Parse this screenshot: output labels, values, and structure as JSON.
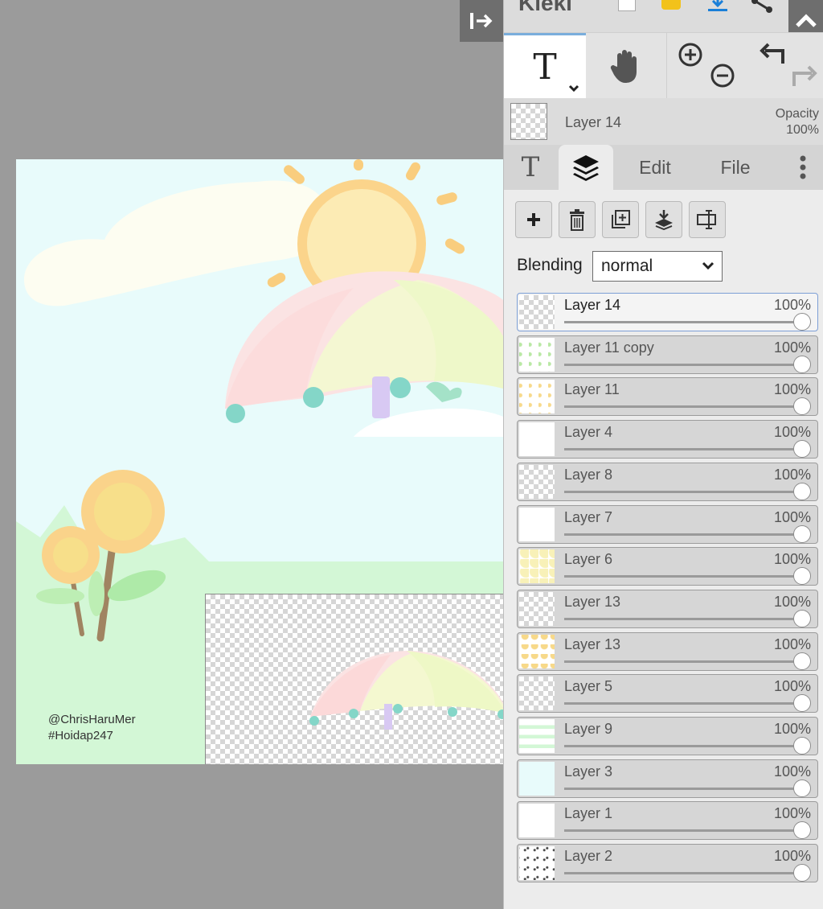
{
  "app": {
    "name": "Kleki"
  },
  "colors": {
    "accent": "#7aaedc",
    "panel": "#dcdcdc",
    "dark_button": "#6e6e6e"
  },
  "artwork": {
    "credit_line1": "@ChrisHaruMer",
    "credit_line2": "#Hoidap247"
  },
  "toolbar": {
    "text_tool_glyph": "T",
    "hand_tool_icon": "hand-icon",
    "zoom_in_icon": "zoom-in-icon",
    "zoom_out_icon": "zoom-out-icon",
    "undo_icon": "undo-icon",
    "redo_icon": "redo-icon"
  },
  "current_layer": {
    "name": "Layer 14",
    "opacity_label": "Opacity",
    "opacity_value": "100%"
  },
  "tabs": {
    "text_glyph": "T",
    "layers_icon": "layers-icon",
    "edit": "Edit",
    "file": "File"
  },
  "blending": {
    "label": "Blending",
    "value": "normal"
  },
  "layers": [
    {
      "name": "Layer 14",
      "opacity": "100%",
      "active": true
    },
    {
      "name": "Layer 11 copy",
      "opacity": "100%"
    },
    {
      "name": "Layer 11",
      "opacity": "100%"
    },
    {
      "name": "Layer 4",
      "opacity": "100%"
    },
    {
      "name": "Layer 8",
      "opacity": "100%"
    },
    {
      "name": "Layer 7",
      "opacity": "100%"
    },
    {
      "name": "Layer 6",
      "opacity": "100%"
    },
    {
      "name": "Layer 13",
      "opacity": "100%"
    },
    {
      "name": "Layer 13",
      "opacity": "100%"
    },
    {
      "name": "Layer 5",
      "opacity": "100%"
    },
    {
      "name": "Layer 9",
      "opacity": "100%"
    },
    {
      "name": "Layer 3",
      "opacity": "100%"
    },
    {
      "name": "Layer 1",
      "opacity": "100%"
    },
    {
      "name": "Layer 2",
      "opacity": "100%"
    }
  ]
}
